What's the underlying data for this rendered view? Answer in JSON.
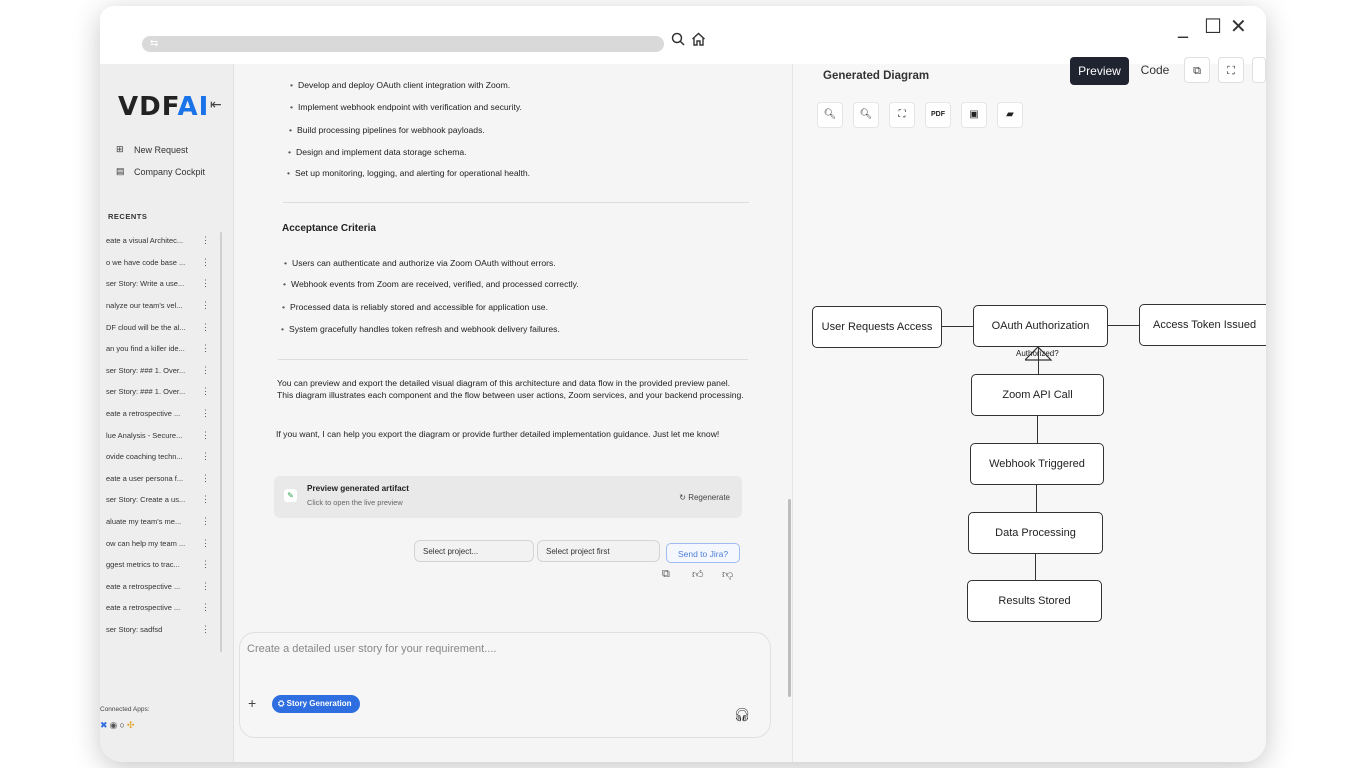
{
  "titlebar": {
    "search_icon": "search-icon",
    "home_icon": "home-icon",
    "minimize": "_",
    "maximize": "☐",
    "close": "✕"
  },
  "sidebar": {
    "logo_prefix": "VDF",
    "logo_suffix": "AI",
    "new_request": "New Request",
    "company_cockpit": "Company Cockpit",
    "recents_heading": "RECENTS",
    "recents": [
      "eate a visual Architec...",
      "o we have code base ...",
      "ser Story: Write a use...",
      "nalyze our team's vel...",
      "DF cloud will be the al...",
      "an you find a killer ide...",
      "ser Story: ### 1. Over...",
      "ser Story: ### 1. Over...",
      "eate a retrospective ...",
      "lue Analysis - Secure...",
      "ovide coaching techn...",
      "eate a user persona f...",
      "ser Story: Create a us...",
      "aluate my team's me...",
      "ow can help my team ...",
      "ggest metrics to trac...",
      "eate a retrospective ...",
      "eate a retrospective ...",
      "ser Story: sadfsd"
    ],
    "connected_apps": "Connected Apps:"
  },
  "chat": {
    "bullets_top": [
      "Develop and deploy OAuth client integration with Zoom.",
      "Implement webhook endpoint with verification and security.",
      "Build processing pipelines for webhook payloads.",
      "Design and implement data storage schema.",
      "Set up monitoring, logging, and alerting for operational health."
    ],
    "acceptance_heading": "Acceptance Criteria",
    "acceptance": [
      "Users can authenticate and authorize via Zoom OAuth without errors.",
      "Webhook events from Zoom are received, verified, and processed correctly.",
      "Processed data is reliably stored and accessible for application use.",
      "System gracefully handles token refresh and webhook delivery failures."
    ],
    "para1": "You can preview and export the detailed visual diagram of this architecture and data flow in the provided preview panel. This diagram illustrates each component and the flow between user actions, Zoom services, and your backend processing.",
    "para2": "If you want, I can help you export the diagram or provide further detailed implementation guidance. Just let me know!",
    "artifact_title": "Preview generated artifact",
    "artifact_sub": "Click to open the live preview",
    "regenerate": "↻ Regenerate",
    "select_project": "Select project...",
    "select_first": "Select project first",
    "send_jira": "Send to Jira?",
    "input_placeholder": "Create a detailed user story for your requirement....",
    "chip": "⛭ Story Generation"
  },
  "panel": {
    "title": "Generated Diagram",
    "preview": "Preview",
    "code": "Code",
    "nodes": {
      "user_requests": "User Requests Access",
      "oauth": "OAuth Authorization",
      "token": "Access Token Issued",
      "zoom_api": "Zoom API Call",
      "webhook": "Webhook Triggered",
      "data_proc": "Data Processing",
      "results": "Results Stored"
    },
    "edge_label": "Authorized?"
  }
}
